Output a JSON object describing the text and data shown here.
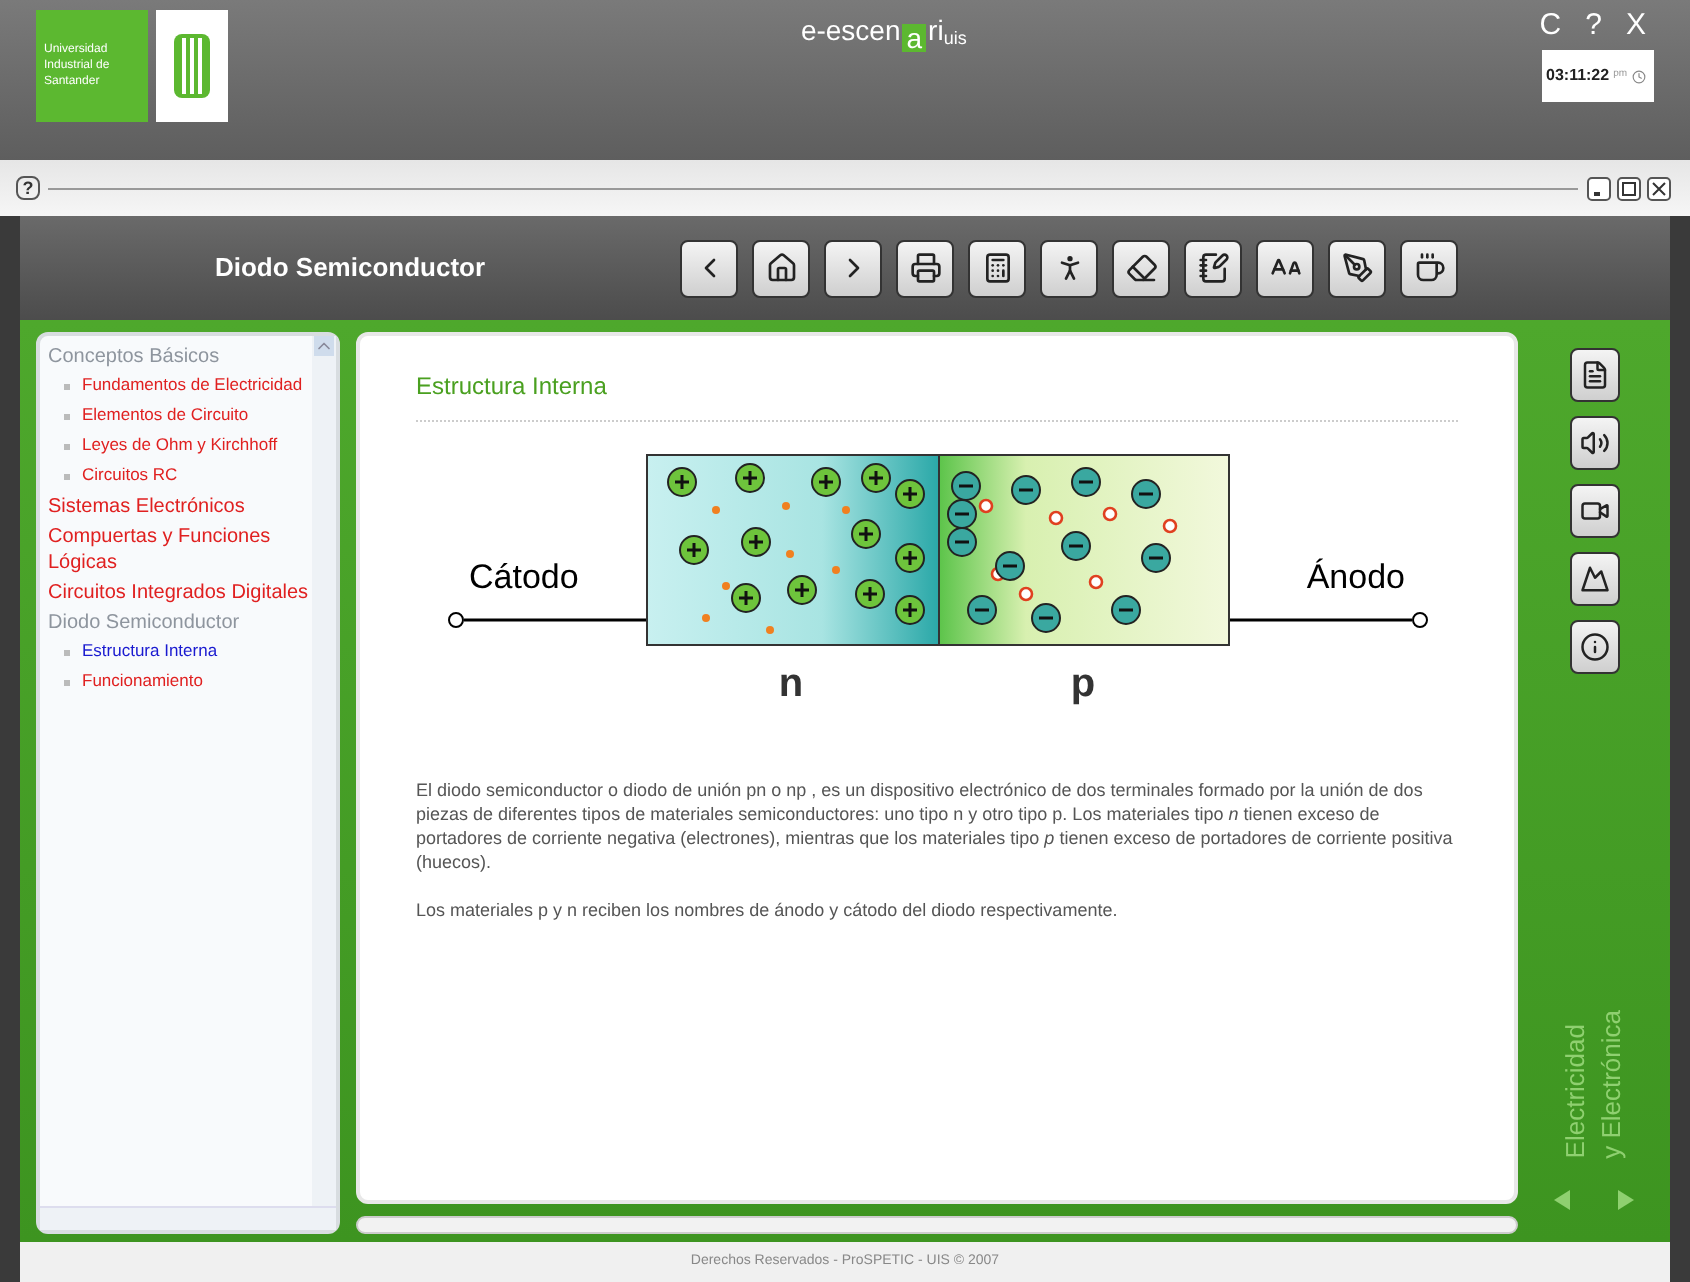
{
  "header": {
    "university": "Universidad Industrial de Santander",
    "brand": {
      "before": "e-escen",
      "boxed": "a",
      "after": "ri",
      "suffix": "uis"
    },
    "window_buttons": [
      "C",
      "?",
      "X"
    ],
    "clock": {
      "time": "03:11:22",
      "period": "pm"
    }
  },
  "subbar": {
    "help": "?"
  },
  "toolbar": {
    "title": "Diodo Semiconductor",
    "buttons": [
      {
        "kind": "back"
      },
      {
        "kind": "home"
      },
      {
        "kind": "forward"
      },
      {
        "kind": "print"
      },
      {
        "kind": "calculator"
      },
      {
        "kind": "figure"
      },
      {
        "kind": "eraser"
      },
      {
        "kind": "notes"
      },
      {
        "kind": "glossary"
      },
      {
        "kind": "pen"
      },
      {
        "kind": "cup"
      }
    ]
  },
  "sidebar": {
    "items": [
      {
        "label": "Conceptos Básicos",
        "expanded": true,
        "children": [
          {
            "label": "Fundamentos de Electricidad",
            "selected": false
          },
          {
            "label": "Elementos de Circuito",
            "selected": false
          },
          {
            "label": "Leyes de Ohm y Kirchhoff",
            "selected": false
          },
          {
            "label": "Circuitos RC",
            "selected": false
          }
        ]
      },
      {
        "label": "Sistemas Electrónicos",
        "expanded": false
      },
      {
        "label": "Compuertas y Funciones Lógicas",
        "expanded": false
      },
      {
        "label": "Circuitos Integrados Digitales",
        "expanded": false
      },
      {
        "label": "Diodo Semiconductor",
        "expanded": true,
        "children": [
          {
            "label": "Estructura Interna",
            "selected": true
          },
          {
            "label": "Funcionamiento",
            "selected": false
          }
        ]
      }
    ]
  },
  "content": {
    "heading": "Estructura Interna",
    "diagram": {
      "cathode": "Cátodo",
      "anode": "Ánodo",
      "n_label": "n",
      "p_label": "p"
    },
    "paragraphs": [
      "El diodo semiconductor o diodo de unión pn o np , es un dispositivo electrónico de dos terminales formado por la unión de dos piezas de diferentes tipos de materiales semiconductores: uno tipo n y otro tipo p. Los materiales tipo *n* tienen exceso de portadores de corriente negativa (electrones), mientras que los materiales tipo *p* tienen exceso de portadores de corriente positiva (huecos).",
      "Los materiales p y n reciben los nombres de ánodo y cátodo del diodo respectivamente."
    ]
  },
  "side_tools": [
    {
      "kind": "document"
    },
    {
      "kind": "audio"
    },
    {
      "kind": "video"
    },
    {
      "kind": "image"
    },
    {
      "kind": "info"
    }
  ],
  "side_caption": [
    "Electricidad",
    "y Electrónica"
  ],
  "footer": "Derechos Reservados - ProSPETIC - UIS © 2007"
}
